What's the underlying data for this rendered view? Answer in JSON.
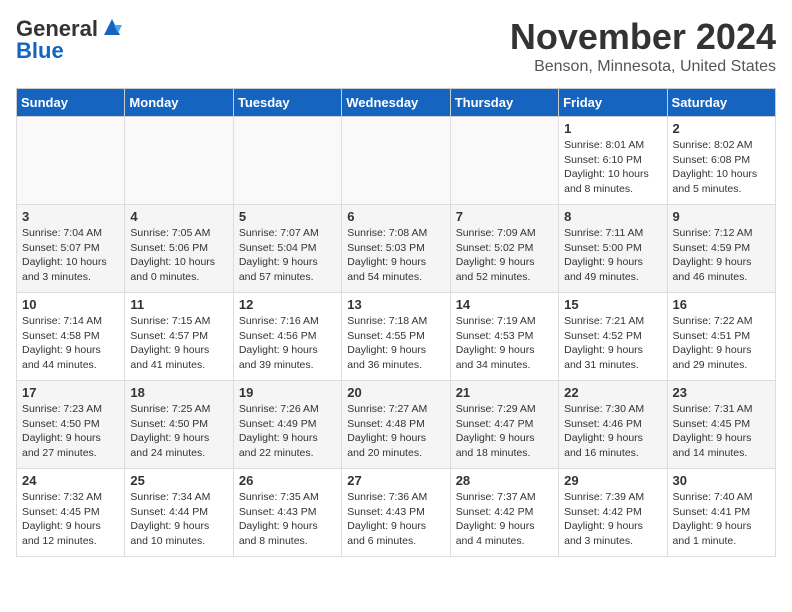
{
  "logo": {
    "general": "General",
    "blue": "Blue"
  },
  "header": {
    "title": "November 2024",
    "location": "Benson, Minnesota, United States"
  },
  "weekdays": [
    "Sunday",
    "Monday",
    "Tuesday",
    "Wednesday",
    "Thursday",
    "Friday",
    "Saturday"
  ],
  "weeks": [
    [
      {
        "day": "",
        "info": ""
      },
      {
        "day": "",
        "info": ""
      },
      {
        "day": "",
        "info": ""
      },
      {
        "day": "",
        "info": ""
      },
      {
        "day": "",
        "info": ""
      },
      {
        "day": "1",
        "info": "Sunrise: 8:01 AM\nSunset: 6:10 PM\nDaylight: 10 hours\nand 8 minutes."
      },
      {
        "day": "2",
        "info": "Sunrise: 8:02 AM\nSunset: 6:08 PM\nDaylight: 10 hours\nand 5 minutes."
      }
    ],
    [
      {
        "day": "3",
        "info": "Sunrise: 7:04 AM\nSunset: 5:07 PM\nDaylight: 10 hours\nand 3 minutes."
      },
      {
        "day": "4",
        "info": "Sunrise: 7:05 AM\nSunset: 5:06 PM\nDaylight: 10 hours\nand 0 minutes."
      },
      {
        "day": "5",
        "info": "Sunrise: 7:07 AM\nSunset: 5:04 PM\nDaylight: 9 hours\nand 57 minutes."
      },
      {
        "day": "6",
        "info": "Sunrise: 7:08 AM\nSunset: 5:03 PM\nDaylight: 9 hours\nand 54 minutes."
      },
      {
        "day": "7",
        "info": "Sunrise: 7:09 AM\nSunset: 5:02 PM\nDaylight: 9 hours\nand 52 minutes."
      },
      {
        "day": "8",
        "info": "Sunrise: 7:11 AM\nSunset: 5:00 PM\nDaylight: 9 hours\nand 49 minutes."
      },
      {
        "day": "9",
        "info": "Sunrise: 7:12 AM\nSunset: 4:59 PM\nDaylight: 9 hours\nand 46 minutes."
      }
    ],
    [
      {
        "day": "10",
        "info": "Sunrise: 7:14 AM\nSunset: 4:58 PM\nDaylight: 9 hours\nand 44 minutes."
      },
      {
        "day": "11",
        "info": "Sunrise: 7:15 AM\nSunset: 4:57 PM\nDaylight: 9 hours\nand 41 minutes."
      },
      {
        "day": "12",
        "info": "Sunrise: 7:16 AM\nSunset: 4:56 PM\nDaylight: 9 hours\nand 39 minutes."
      },
      {
        "day": "13",
        "info": "Sunrise: 7:18 AM\nSunset: 4:55 PM\nDaylight: 9 hours\nand 36 minutes."
      },
      {
        "day": "14",
        "info": "Sunrise: 7:19 AM\nSunset: 4:53 PM\nDaylight: 9 hours\nand 34 minutes."
      },
      {
        "day": "15",
        "info": "Sunrise: 7:21 AM\nSunset: 4:52 PM\nDaylight: 9 hours\nand 31 minutes."
      },
      {
        "day": "16",
        "info": "Sunrise: 7:22 AM\nSunset: 4:51 PM\nDaylight: 9 hours\nand 29 minutes."
      }
    ],
    [
      {
        "day": "17",
        "info": "Sunrise: 7:23 AM\nSunset: 4:50 PM\nDaylight: 9 hours\nand 27 minutes."
      },
      {
        "day": "18",
        "info": "Sunrise: 7:25 AM\nSunset: 4:50 PM\nDaylight: 9 hours\nand 24 minutes."
      },
      {
        "day": "19",
        "info": "Sunrise: 7:26 AM\nSunset: 4:49 PM\nDaylight: 9 hours\nand 22 minutes."
      },
      {
        "day": "20",
        "info": "Sunrise: 7:27 AM\nSunset: 4:48 PM\nDaylight: 9 hours\nand 20 minutes."
      },
      {
        "day": "21",
        "info": "Sunrise: 7:29 AM\nSunset: 4:47 PM\nDaylight: 9 hours\nand 18 minutes."
      },
      {
        "day": "22",
        "info": "Sunrise: 7:30 AM\nSunset: 4:46 PM\nDaylight: 9 hours\nand 16 minutes."
      },
      {
        "day": "23",
        "info": "Sunrise: 7:31 AM\nSunset: 4:45 PM\nDaylight: 9 hours\nand 14 minutes."
      }
    ],
    [
      {
        "day": "24",
        "info": "Sunrise: 7:32 AM\nSunset: 4:45 PM\nDaylight: 9 hours\nand 12 minutes."
      },
      {
        "day": "25",
        "info": "Sunrise: 7:34 AM\nSunset: 4:44 PM\nDaylight: 9 hours\nand 10 minutes."
      },
      {
        "day": "26",
        "info": "Sunrise: 7:35 AM\nSunset: 4:43 PM\nDaylight: 9 hours\nand 8 minutes."
      },
      {
        "day": "27",
        "info": "Sunrise: 7:36 AM\nSunset: 4:43 PM\nDaylight: 9 hours\nand 6 minutes."
      },
      {
        "day": "28",
        "info": "Sunrise: 7:37 AM\nSunset: 4:42 PM\nDaylight: 9 hours\nand 4 minutes."
      },
      {
        "day": "29",
        "info": "Sunrise: 7:39 AM\nSunset: 4:42 PM\nDaylight: 9 hours\nand 3 minutes."
      },
      {
        "day": "30",
        "info": "Sunrise: 7:40 AM\nSunset: 4:41 PM\nDaylight: 9 hours\nand 1 minute."
      }
    ]
  ]
}
